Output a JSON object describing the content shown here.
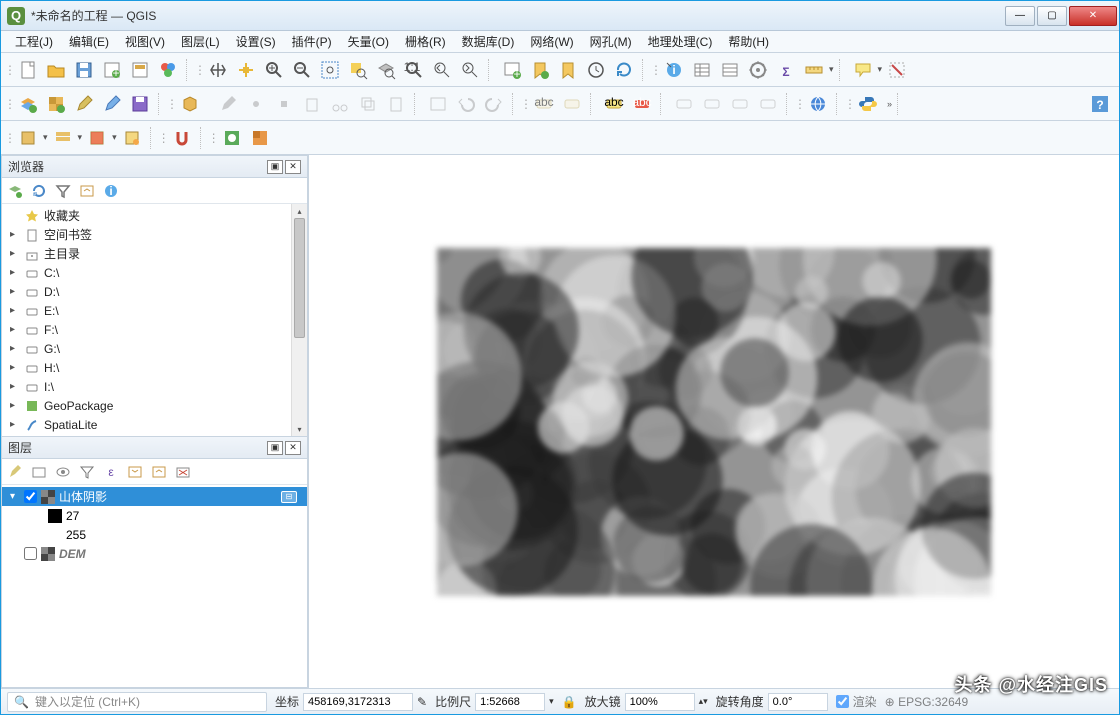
{
  "window": {
    "title": "*未命名的工程 — QGIS",
    "app_initial": "Q"
  },
  "menu": [
    "工程(J)",
    "编辑(E)",
    "视图(V)",
    "图层(L)",
    "设置(S)",
    "插件(P)",
    "矢量(O)",
    "栅格(R)",
    "数据库(D)",
    "网络(W)",
    "网孔(M)",
    "地理处理(C)",
    "帮助(H)"
  ],
  "browser": {
    "title": "浏览器",
    "items": [
      {
        "icon": "star",
        "label": "收藏夹",
        "expand": ""
      },
      {
        "icon": "bookmark",
        "label": "空间书签",
        "expand": "▸"
      },
      {
        "icon": "home",
        "label": "主目录",
        "expand": "▸"
      },
      {
        "icon": "drive",
        "label": "C:\\",
        "expand": "▸"
      },
      {
        "icon": "drive",
        "label": "D:\\",
        "expand": "▸"
      },
      {
        "icon": "drive",
        "label": "E:\\",
        "expand": "▸"
      },
      {
        "icon": "drive",
        "label": "F:\\",
        "expand": "▸"
      },
      {
        "icon": "drive",
        "label": "G:\\",
        "expand": "▸"
      },
      {
        "icon": "drive",
        "label": "H:\\",
        "expand": "▸"
      },
      {
        "icon": "drive",
        "label": "I:\\",
        "expand": "▸"
      },
      {
        "icon": "geopackage",
        "label": "GeoPackage",
        "expand": "▸"
      },
      {
        "icon": "spatialite",
        "label": "SpatiaLite",
        "expand": "▸"
      }
    ]
  },
  "layers": {
    "title": "图层",
    "items": [
      {
        "type": "layer",
        "checked": true,
        "label": "山体阴影",
        "selected": true,
        "expand": "▾"
      },
      {
        "type": "value",
        "swatch": "#000000",
        "label": "27"
      },
      {
        "type": "value",
        "swatch": "",
        "label": "255"
      },
      {
        "type": "layer",
        "checked": false,
        "label": "DEM",
        "dem": true,
        "expand": ""
      }
    ]
  },
  "status": {
    "search_placeholder": "键入以定位 (Ctrl+K)",
    "coord_label": "坐标",
    "coord_value": "458169,3172313",
    "scale_label": "比例尺",
    "scale_value": "1:52668",
    "mag_label": "放大镜",
    "mag_value": "100%",
    "rot_label": "旋转角度",
    "rot_value": "0.0°",
    "render_label": "渲染",
    "epsg": "EPSG:32649"
  },
  "watermark": "头条 @水经注GIS"
}
